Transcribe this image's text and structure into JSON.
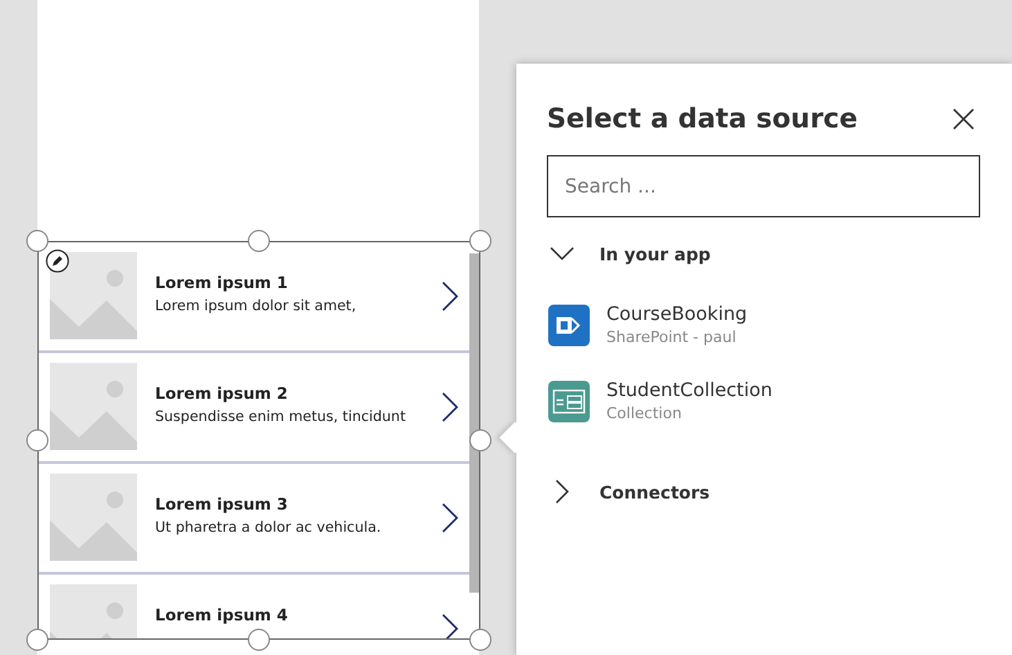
{
  "gallery": {
    "selected": true,
    "items": [
      {
        "title": "Lorem ipsum 1",
        "subtitle": "Lorem ipsum dolor sit amet,"
      },
      {
        "title": "Lorem ipsum 2",
        "subtitle": "Suspendisse enim metus, tincidunt"
      },
      {
        "title": "Lorem ipsum 3",
        "subtitle": "Ut pharetra a dolor ac vehicula."
      },
      {
        "title": "Lorem ipsum 4"
      }
    ]
  },
  "panel": {
    "title": "Select a data source",
    "search": {
      "placeholder": "Search ..."
    },
    "sections": [
      {
        "label": "In your app",
        "expanded": true,
        "items": [
          {
            "kind": "sharepoint",
            "name": "CourseBooking",
            "detail": "SharePoint - paul"
          },
          {
            "kind": "collection",
            "name": "StudentCollection",
            "detail": "Collection"
          }
        ]
      },
      {
        "label": "Connectors",
        "expanded": false
      }
    ]
  }
}
